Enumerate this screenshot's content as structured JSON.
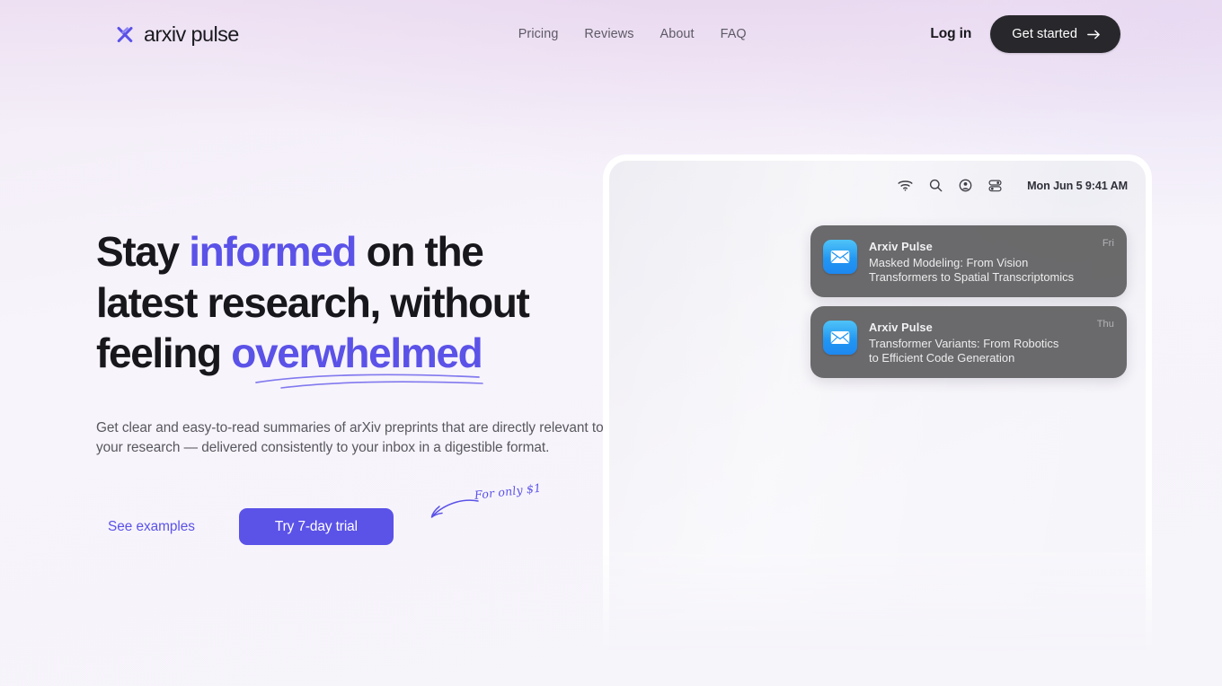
{
  "brand": {
    "name": "arxiv pulse",
    "mark_icon": "x-logo-icon",
    "accent_color": "#5b52e8"
  },
  "nav": {
    "items": [
      {
        "label": "Pricing"
      },
      {
        "label": "Reviews"
      },
      {
        "label": "About"
      },
      {
        "label": "FAQ"
      }
    ],
    "login_label": "Log in",
    "cta_label": "Get started",
    "cta_icon": "arrow-right-icon",
    "cta_bg": "#28282c"
  },
  "hero": {
    "headline": {
      "line1_a": "Stay ",
      "line1_accent": "informed",
      "line1_b": " on the",
      "line2": "latest research, without",
      "line3_a": "feeling ",
      "line3_accent": "overwhelmed"
    },
    "subhead": "Get clear and easy-to-read summaries of arXiv preprints that are directly relevant to your research — delivered consistently to your inbox in a digestible format.",
    "secondary_cta": "See examples",
    "primary_cta": "Try 7-day trial",
    "primary_cta_bg": "#5b52e8",
    "annotation": "For only $1",
    "annotation_icon": "curved-arrow-icon"
  },
  "device": {
    "menubar": {
      "icons": [
        "wifi-icon",
        "search-icon",
        "control-center-user-icon",
        "control-center-icon"
      ],
      "clock": "Mon Jun 5  9:41 AM"
    },
    "notifications": [
      {
        "app": "Arxiv Pulse",
        "icon": "mail-icon",
        "message": "Masked Modeling: From Vision\nTransformers to Spatial Transcriptomics",
        "time": "Fri"
      },
      {
        "app": "Arxiv Pulse",
        "icon": "mail-icon",
        "message": "Transformer Variants: From Robotics\nto Efficient Code Generation",
        "time": "Thu"
      }
    ]
  }
}
